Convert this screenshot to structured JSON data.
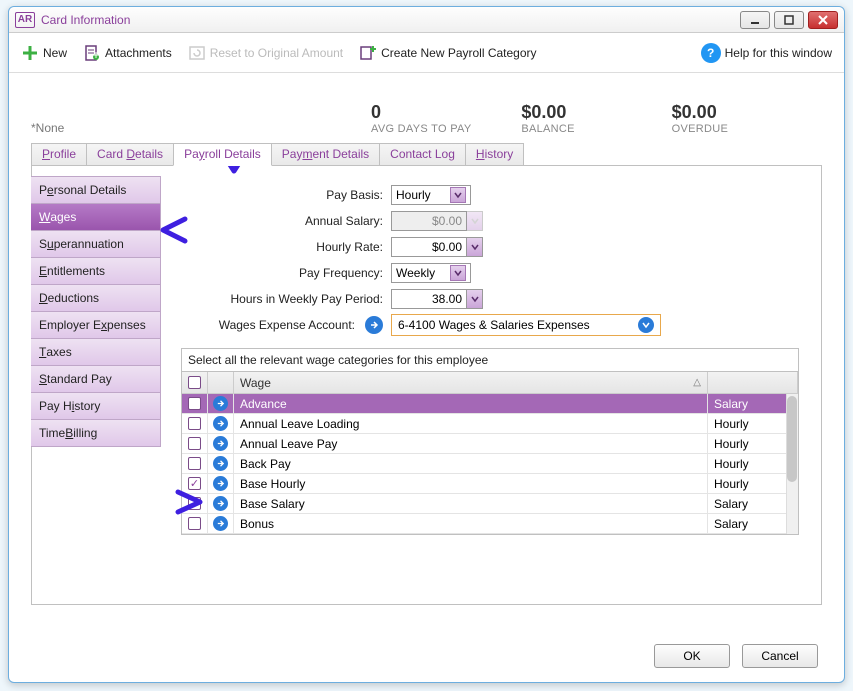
{
  "window": {
    "app_badge": "AR",
    "title": "Card Information"
  },
  "toolbar": {
    "new_label": "New",
    "attachments_label": "Attachments",
    "reset_label": "Reset to Original Amount",
    "create_category_label": "Create New Payroll Category",
    "help_label": "Help for this window"
  },
  "summary": {
    "name": "*None",
    "stats": [
      {
        "value": "0",
        "label": "AVG DAYS TO PAY"
      },
      {
        "value": "$0.00",
        "label": "BALANCE"
      },
      {
        "value": "$0.00",
        "label": "OVERDUE"
      }
    ]
  },
  "tabs": [
    {
      "label": "Profile",
      "accel": "P"
    },
    {
      "label": "Card Details",
      "accel": "D"
    },
    {
      "label": "Payroll Details",
      "accel": "y",
      "active": true
    },
    {
      "label": "Payment Details",
      "accel": "m"
    },
    {
      "label": "Contact Log",
      "accel": "g"
    },
    {
      "label": "History",
      "accel": "H"
    }
  ],
  "sidetabs": [
    {
      "label": "Personal Details",
      "accel": "e"
    },
    {
      "label": "Wages",
      "accel": "W",
      "active": true
    },
    {
      "label": "Superannuation",
      "accel": "u"
    },
    {
      "label": "Entitlements",
      "accel": "E"
    },
    {
      "label": "Deductions",
      "accel": "D"
    },
    {
      "label": "Employer Expenses",
      "accel": "x"
    },
    {
      "label": "Taxes",
      "accel": "T"
    },
    {
      "label": "Standard Pay",
      "accel": "S"
    },
    {
      "label": "Pay History",
      "accel": "i"
    },
    {
      "label": "Time Billing",
      "accel": "B"
    }
  ],
  "form": {
    "pay_basis_label": "Pay Basis:",
    "pay_basis_value": "Hourly",
    "annual_salary_label": "Annual Salary:",
    "annual_salary_value": "$0.00",
    "hourly_rate_label": "Hourly Rate:",
    "hourly_rate_value": "$0.00",
    "pay_frequency_label": "Pay Frequency:",
    "pay_frequency_value": "Weekly",
    "hours_label": "Hours in Weekly Pay Period:",
    "hours_value": "38.00",
    "wages_account_label": "Wages Expense Account:",
    "wages_account_value": "6-4100 Wages & Salaries Expenses"
  },
  "table": {
    "caption": "Select all the relevant wage categories for this employee",
    "col_checkbox": "",
    "col_go": "",
    "col_name": "Wage",
    "col_type": "",
    "rows": [
      {
        "checked": false,
        "name": "Advance",
        "type": "Salary",
        "selected": true
      },
      {
        "checked": false,
        "name": "Annual Leave Loading",
        "type": "Hourly"
      },
      {
        "checked": false,
        "name": "Annual Leave Pay",
        "type": "Hourly"
      },
      {
        "checked": false,
        "name": "Back Pay",
        "type": "Hourly"
      },
      {
        "checked": true,
        "name": "Base Hourly",
        "type": "Hourly"
      },
      {
        "checked": false,
        "name": "Base Salary",
        "type": "Salary"
      },
      {
        "checked": false,
        "name": "Bonus",
        "type": "Salary"
      }
    ]
  },
  "footer": {
    "ok_label": "OK",
    "cancel_label": "Cancel"
  }
}
